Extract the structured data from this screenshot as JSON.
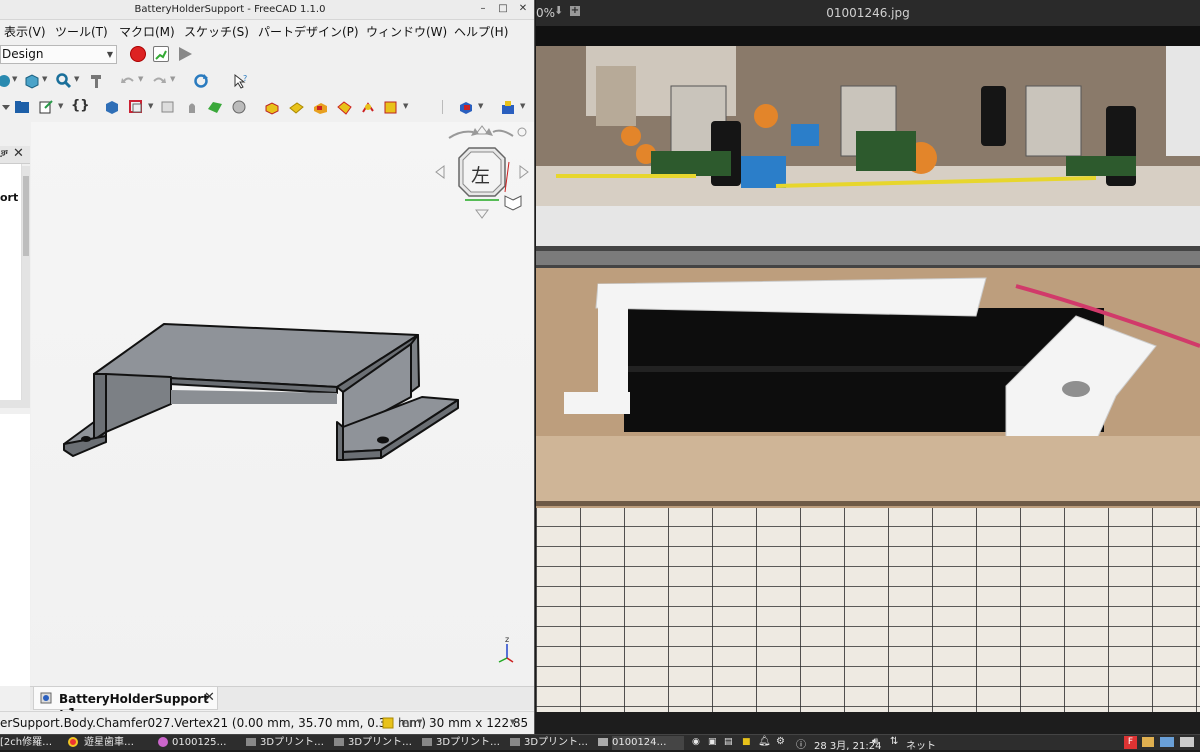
{
  "freecad": {
    "window_title": "BatteryHolderSupport - FreeCAD 1.1.0",
    "menu": [
      "表示(V)",
      "ツール(T)",
      "マクロ(M)",
      "スケッチ(S)",
      "パートデザイン(P)",
      "ウィンドウ(W)",
      "ヘルプ(H)"
    ],
    "workbench": "Design",
    "tree_item": "ort",
    "navcube_face": "左",
    "document_tab": "BatteryHolderSupport : 1",
    "status_text": "erSupport.Body.Chamfer027.Vertex21 (0.00 mm, 35.70 mm, 0.30 mm)",
    "status_units": "len",
    "status_dims": "30 mm x 122.85",
    "axis_label": "z"
  },
  "viewer": {
    "zoom": "0%",
    "filename": "01001246.jpg"
  },
  "taskbar": {
    "tasks": [
      "[2ch修羅…",
      "遊星歯車…",
      "0100125…",
      "3Dプリント…",
      "3Dプリント…",
      "3Dプリント…",
      "3Dプリント…",
      "0100124…"
    ],
    "date": "28 3月, 21:24",
    "network": "ネット"
  },
  "colors": {
    "part_top": "#8f9399",
    "part_side": "#6b6f74",
    "part_edge": "#111111",
    "record_red": "#dd2222"
  }
}
